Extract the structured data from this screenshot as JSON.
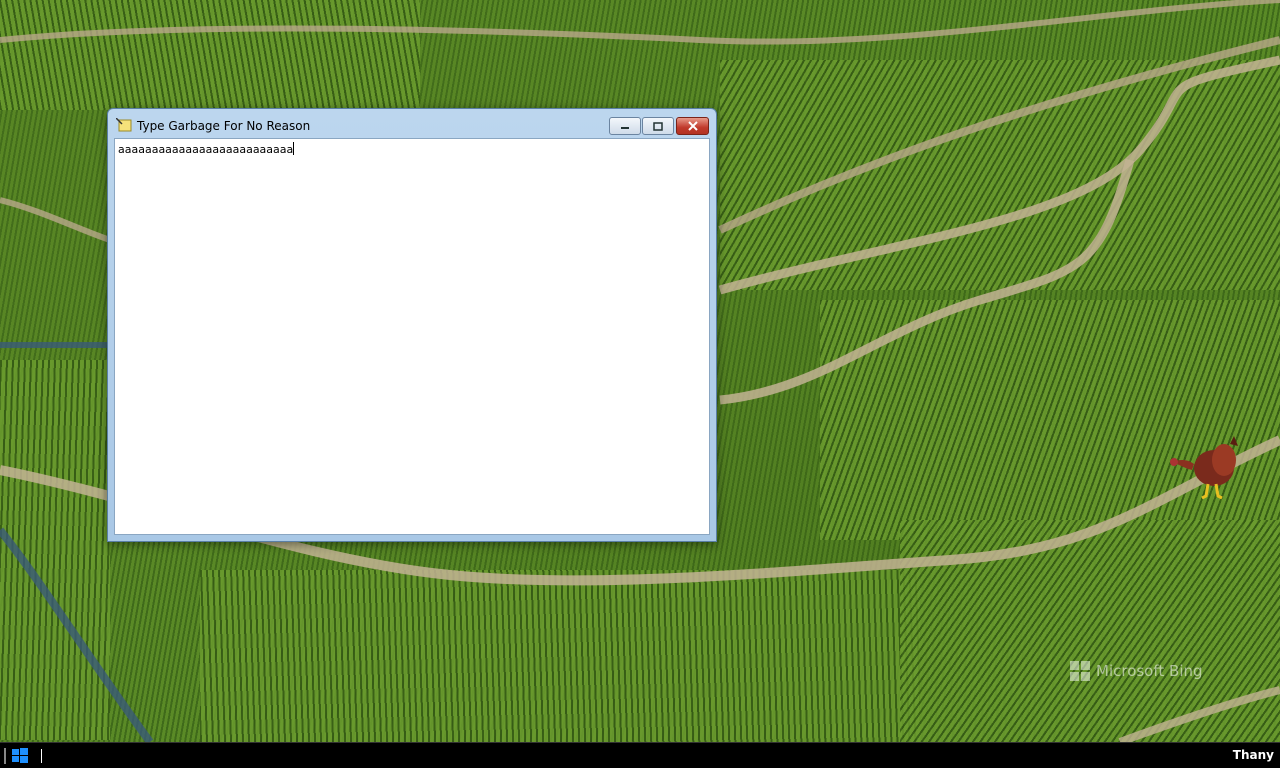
{
  "window": {
    "title": "Type Garbage For No Reason",
    "text": "aaaaaaaaaaaaaaaaaaaaaaaaaa"
  },
  "wallpaper": {
    "watermark": "Microsoft Bing"
  },
  "taskbar": {
    "username": "Thany"
  },
  "icons": {
    "app": "notepad-icon",
    "minimize": "minimize-icon",
    "maximize": "maximize-icon",
    "close": "close-icon",
    "start": "windows-logo-icon"
  },
  "colors": {
    "close_button": "#c0392b",
    "window_frame": "#bcd6ee",
    "taskbar": "#000000"
  }
}
